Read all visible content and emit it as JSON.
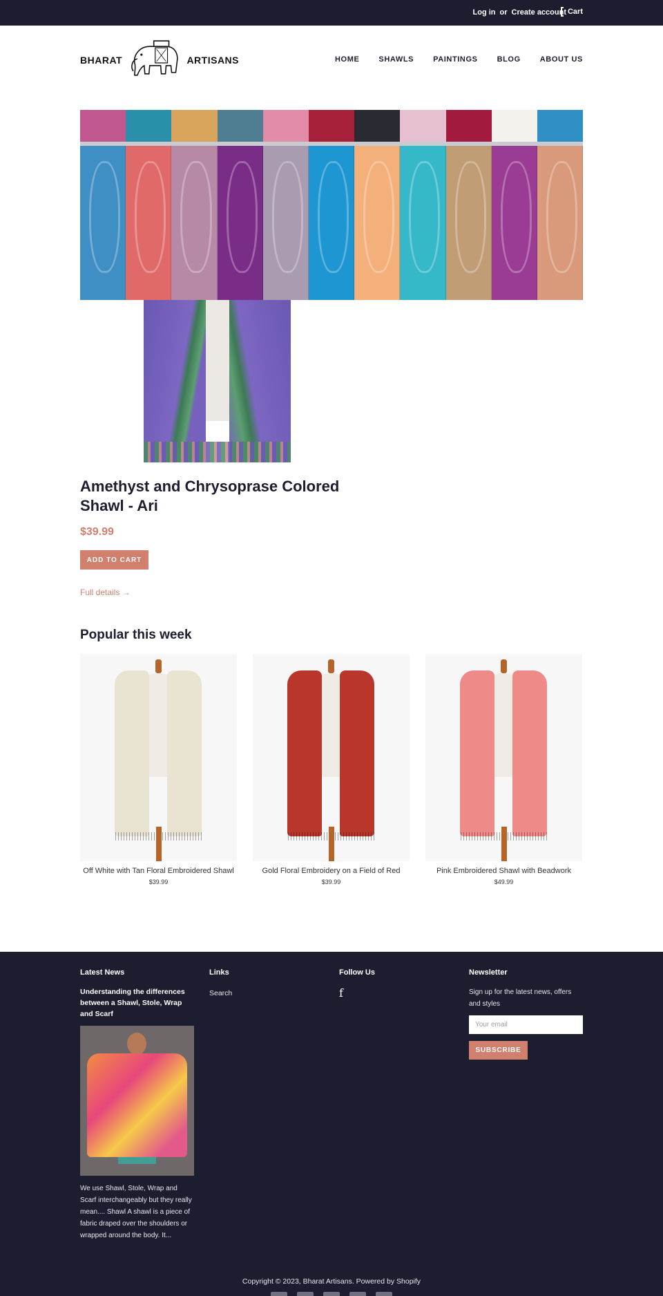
{
  "topbar": {
    "login": "Log in",
    "or": "or",
    "create_account": "Create account",
    "cart": "Cart"
  },
  "logo": {
    "word_left": "BHARAT",
    "word_right": "ARTISANS"
  },
  "nav": [
    {
      "label": "HOME"
    },
    {
      "label": "SHAWLS"
    },
    {
      "label": "PAINTINGS"
    },
    {
      "label": "BLOG"
    },
    {
      "label": "ABOUT US"
    }
  ],
  "product": {
    "title": "Amethyst and Chrysoprase Colored Shawl - Ari",
    "price": "$39.99",
    "add_to_cart": "ADD TO CART",
    "full_details": "Full details →"
  },
  "popular": {
    "heading": "Popular this week",
    "items": [
      {
        "name": "Off White with Tan Floral Embroidered Shawl",
        "price": "$39.99",
        "color": "#e9e3d2"
      },
      {
        "name": "Gold Floral Embroidery on a Field of Red",
        "price": "$39.99",
        "color": "#b8372a"
      },
      {
        "name": "Pink Embroidered Shawl with Beadwork",
        "price": "$49.99",
        "color": "#ee8b88"
      }
    ]
  },
  "footer": {
    "latest_news": {
      "heading": "Latest News",
      "headline": "Understanding the differences between a Shawl, Stole, Wrap and Scarf",
      "excerpt": "We use Shawl, Stole, Wrap and Scarf interchangeably but they really mean.... Shawl A shawl is a piece of fabric draped over the shoulders or wrapped around the body. It..."
    },
    "links": {
      "heading": "Links",
      "items": [
        {
          "label": "Search"
        }
      ]
    },
    "follow": {
      "heading": "Follow Us",
      "icon": "facebook-icon",
      "glyph": "f"
    },
    "newsletter": {
      "heading": "Newsletter",
      "text": "Sign up for the latest news, offers and styles",
      "placeholder": "Your email",
      "subscribe": "SUBSCRIBE"
    },
    "copyright": "Copyright © 2023, Bharat Artisans. Powered by Shopify"
  },
  "colors": {
    "dark": "#1c1d2e",
    "accent": "#d1806d"
  }
}
